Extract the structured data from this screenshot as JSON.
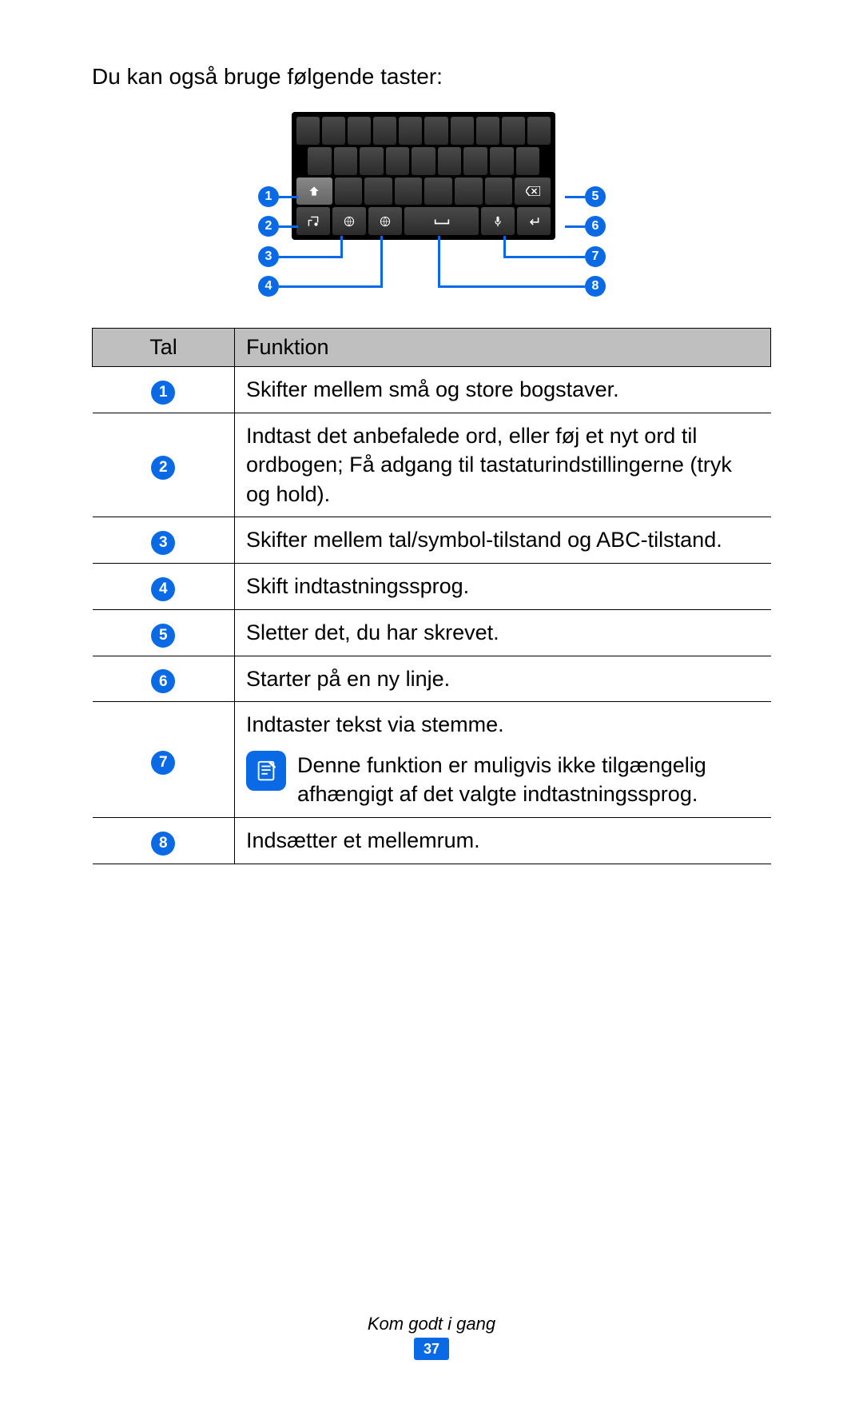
{
  "intro": "Du kan også bruge følgende taster:",
  "table": {
    "header_num": "Tal",
    "header_func": "Funktion",
    "rows": [
      {
        "n": "1",
        "text": "Skifter mellem små og store bogstaver."
      },
      {
        "n": "2",
        "text": "Indtast det anbefalede ord, eller føj et nyt ord til ordbogen; Få adgang til tastaturindstillingerne (tryk og hold)."
      },
      {
        "n": "3",
        "text": "Skifter mellem tal/symbol-tilstand og ABC-tilstand."
      },
      {
        "n": "4",
        "text": "Skift indtastningssprog."
      },
      {
        "n": "5",
        "text": "Sletter det, du har skrevet."
      },
      {
        "n": "6",
        "text": "Starter på en ny linje."
      },
      {
        "n": "7",
        "text": "Indtaster tekst via stemme.",
        "note": "Denne funktion er muligvis ikke tilgængelig afhængigt af det valgte indtastningssprog."
      },
      {
        "n": "8",
        "text": "Indsætter et mellemrum."
      }
    ]
  },
  "callouts": [
    "1",
    "2",
    "3",
    "4",
    "5",
    "6",
    "7",
    "8"
  ],
  "footer_section": "Kom godt i gang",
  "page_number": "37"
}
